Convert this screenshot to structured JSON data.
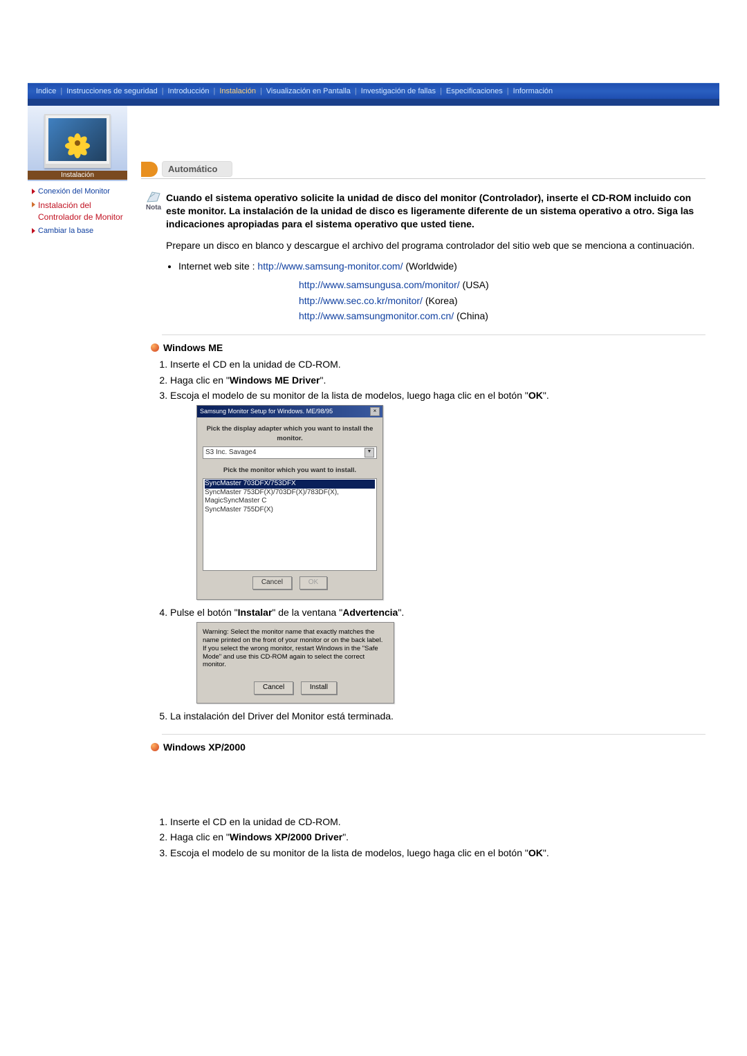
{
  "nav": {
    "items": [
      {
        "label": "Indice"
      },
      {
        "label": "Instrucciones de seguridad"
      },
      {
        "label": "Introducción"
      },
      {
        "label": "Instalación",
        "highlight": true
      },
      {
        "label": "Visualización en Pantalla"
      },
      {
        "label": "Investigación de fallas"
      },
      {
        "label": "Especificaciones"
      },
      {
        "label": "Información"
      }
    ]
  },
  "hero_label": "Instalación",
  "sidebar": {
    "link1": "Conexión del Monitor",
    "link2": "Instalación del Controlador de Monitor",
    "link3": "Cambiar la base"
  },
  "badge": "Automático",
  "nota_label": "Nota",
  "nota_text": "Cuando el sistema operativo solicite la unidad de disco del monitor (Controlador), inserte el CD-ROM incluido con este monitor. La instalación de la unidad de disco es ligeramente diferente de un sistema operativo a otro. Siga las indicaciones apropiadas para el sistema operativo que usted tiene.",
  "prep_text": "Prepare un disco en blanco y descargue el archivo del programa controlador del sitio web que se menciona a continuación.",
  "link_prefix": "Internet web site : ",
  "links": {
    "ww_url": "http://www.samsung-monitor.com/",
    "ww_suffix": " (Worldwide)",
    "usa_url": "http://www.samsungusa.com/monitor/",
    "usa_suffix": " (USA)",
    "kr_url": "http://www.sec.co.kr/monitor/",
    "kr_suffix": " (Korea)",
    "cn_url": "http://www.samsungmonitor.com.cn/",
    "cn_suffix": " (China)"
  },
  "me": {
    "heading": " Windows ME",
    "step1": "Inserte el CD en la unidad de CD-ROM.",
    "step2_a": "Haga clic en \"",
    "step2_b": "Windows ME Driver",
    "step2_c": "\".",
    "step3_a": "Escoja el modelo de su monitor de la lista de modelos, luego haga clic en el botón \"",
    "step3_b": "OK",
    "step3_c": "\".",
    "step4_a": "Pulse el botón \"",
    "step4_b": "Instalar",
    "step4_c": "\" de la ventana \"",
    "step4_d": "Advertencia",
    "step4_e": "\".",
    "step5": "La instalación del Driver del Monitor está terminada."
  },
  "dlg1": {
    "title": "Samsung Monitor Setup for Windows. ME/98/95",
    "label1": "Pick the display adapter which you want to install the monitor.",
    "select_val": "S3 Inc. Savage4",
    "label2": "Pick the monitor which you want to install.",
    "row1": "SyncMaster 703DFX/753DFX",
    "row2": "SyncMaster 753DF(X)/703DF(X)/783DF(X), MagicSyncMaster C",
    "row3": "SyncMaster 755DF(X)",
    "btn_cancel": "Cancel",
    "btn_ok": "OK"
  },
  "dlg2": {
    "text": "Warning: Select the monitor name that exactly matches the name printed on the front of your monitor or on the back label. If you select the wrong monitor, restart Windows in the \"Safe Mode\" and use this CD-ROM again to select the correct monitor.",
    "btn_cancel": "Cancel",
    "btn_install": "Install"
  },
  "xp": {
    "heading": " Windows XP/2000",
    "step1": "Inserte el CD en la unidad de CD-ROM.",
    "step2_a": "Haga clic en \"",
    "step2_b": "Windows XP/2000 Driver",
    "step2_c": "\".",
    "step3_a": "Escoja el modelo de su monitor de la lista de modelos, luego haga clic en el botón \"",
    "step3_b": "OK",
    "step3_c": "\"."
  }
}
